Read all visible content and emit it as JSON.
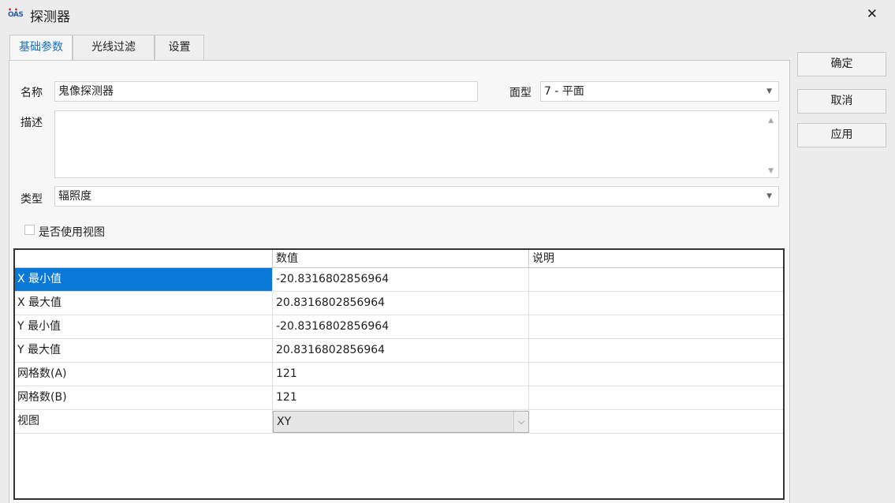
{
  "window": {
    "logo_text": "OAS",
    "title": "探测器",
    "close_glyph": "✕"
  },
  "tabs": [
    {
      "label": "基础参数",
      "active": true
    },
    {
      "label": "光线过滤",
      "active": false
    },
    {
      "label": "设置",
      "active": false
    }
  ],
  "form": {
    "name_label": "名称",
    "name_value": "鬼像探测器",
    "surface_label": "面型",
    "surface_value": "7 - 平面",
    "desc_label": "描述",
    "desc_value": "",
    "type_label": "类型",
    "type_value": "辐照度",
    "use_view_label": "是否使用视图",
    "use_view_checked": false
  },
  "grid": {
    "headers": [
      "",
      "数值",
      "说明"
    ],
    "rows": [
      {
        "name": "X 最小值",
        "value": "-20.8316802856964",
        "desc": "",
        "selected": true
      },
      {
        "name": "X 最大值",
        "value": "20.8316802856964",
        "desc": ""
      },
      {
        "name": "Y 最小值",
        "value": "-20.8316802856964",
        "desc": ""
      },
      {
        "name": "Y 最大值",
        "value": "20.8316802856964",
        "desc": ""
      },
      {
        "name": "网格数(A)",
        "value": "121",
        "desc": ""
      },
      {
        "name": "网格数(B)",
        "value": "121",
        "desc": ""
      },
      {
        "name": "视图",
        "value": "XY",
        "desc": "",
        "is_select": true
      }
    ]
  },
  "buttons": {
    "ok": "确定",
    "cancel": "取消",
    "apply": "应用"
  },
  "colors": {
    "accent": "#1a6fc4",
    "selection": "#0a78d7",
    "window_bg": "#ececec",
    "panel_bg": "#f7f7f7"
  }
}
